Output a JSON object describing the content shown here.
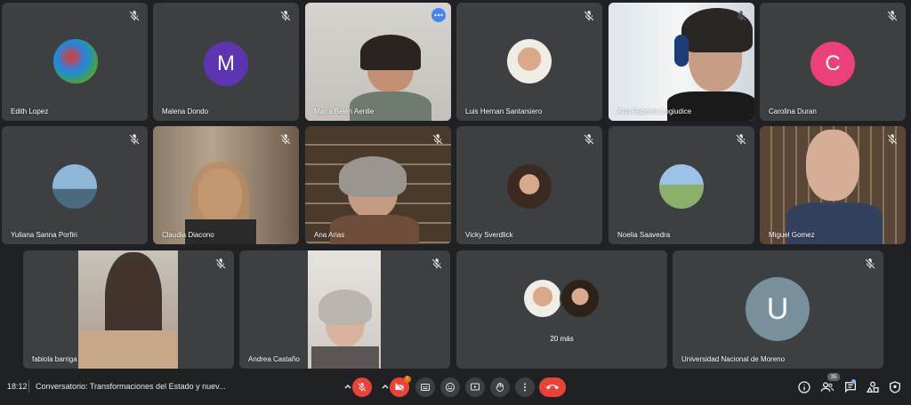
{
  "participants": {
    "edith": {
      "name": "Edith Lopez"
    },
    "malena": {
      "name": "Malena Dondo",
      "initial": "M",
      "color": "#5e35b1"
    },
    "maria": {
      "name": "María Belén Aenlle"
    },
    "luis": {
      "name": "Luis Hernan Santarsiero"
    },
    "ana_gabriela": {
      "name": "Ana Gabriela Logiudice"
    },
    "carolina": {
      "name": "Carolina Duran",
      "initial": "C",
      "color": "#ec407a"
    },
    "yuliana": {
      "name": "Yuliana Sanna Porfiri"
    },
    "claudia": {
      "name": "Claudia Diacono"
    },
    "ana_arias": {
      "name": "Ana Arias"
    },
    "vicky": {
      "name": "Vicky Sverdlick"
    },
    "noelia": {
      "name": "Noelia Saavedra"
    },
    "miguel": {
      "name": "Miguel Gomez"
    },
    "fabiola": {
      "name": "fabiola barriga"
    },
    "andrea": {
      "name": "Andrea Castaño"
    },
    "others": {
      "label": "20 más"
    },
    "universidad": {
      "name": "Universidad Nacional de Moreno",
      "initial": "U",
      "color": "#78909c"
    }
  },
  "toolbar": {
    "time": "18:12",
    "meeting_title": "Conversatorio: Transformaciones del Estado y nuev...",
    "participant_count": "35",
    "notification_badge": "!"
  },
  "icons": [
    "mic-off-icon",
    "camera-off-icon",
    "captions-icon",
    "emoji-icon",
    "present-icon",
    "raise-hand-icon",
    "more-options-icon",
    "hang-up-icon",
    "info-icon",
    "people-icon",
    "chat-icon",
    "activities-icon",
    "host-controls-icon"
  ]
}
